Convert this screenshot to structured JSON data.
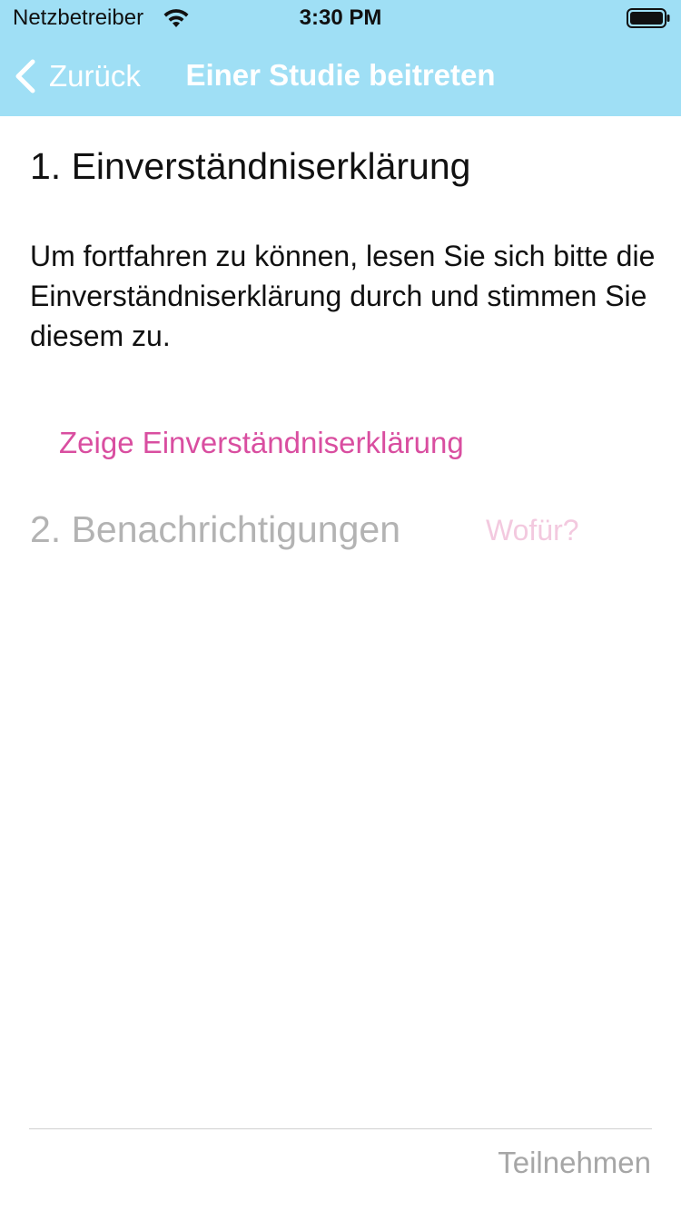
{
  "status_bar": {
    "carrier": "Netzbetreiber",
    "time": "3:30 PM",
    "wifi_icon": "wifi-icon",
    "battery_icon": "battery-full-icon"
  },
  "nav": {
    "back_label": "Zurück",
    "back_icon": "chevron-left-icon",
    "title": "Einer Studie beitreten",
    "bar_color": "#9fdff5"
  },
  "consent": {
    "title": "1. Einverständniserklärung",
    "description": "Um fortfahren zu können, lesen Sie sich bitte die Einverständniserklärung durch und stimmen Sie diesem zu.",
    "link_label": "Zeige Einverständniserklärung",
    "link_color": "#d94ea0"
  },
  "notifications": {
    "title": "2. Benachrichtigungen",
    "why_label": "Wofür?",
    "state": "disabled"
  },
  "footer": {
    "join_label": "Teilnehmen",
    "join_state": "disabled"
  }
}
